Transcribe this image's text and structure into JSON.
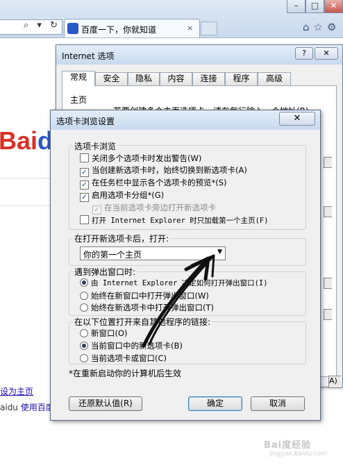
{
  "browser": {
    "window_buttons": [
      "–",
      "□",
      "✕"
    ],
    "tab_title": "百度一下，你就知道",
    "tab_close": "×",
    "address_icons": "⌕ ▾ ↻"
  },
  "page": {
    "logo_part1": "Bai",
    "logo_part2": "d",
    "set_homepage_link": "设为主页",
    "footer_prefix": "aidu",
    "footer_link": "使用百度"
  },
  "internet_options": {
    "title": "Internet 选项",
    "help_button": "?",
    "close_button": "✕",
    "tabs": [
      "常规",
      "安全",
      "隐私",
      "内容",
      "连接",
      "程序",
      "高级"
    ],
    "active_tab": "常规",
    "homepage_group_label": "主页",
    "homepage_desc": "若要创建多个主页选项卡，请在每行输入一个地址(R)。",
    "button_fragment": "A)"
  },
  "tab_settings": {
    "title": "选项卡浏览设置",
    "close_button": "✕",
    "group_tabbed": {
      "label": "选项卡浏览",
      "options": [
        {
          "label": "关闭多个选项卡时发出警告(W)",
          "checked": false,
          "enabled": true
        },
        {
          "label": "当创建新选项卡时，始终切换到新选项卡(A)",
          "checked": true,
          "enabled": true
        },
        {
          "label": "在任务栏中显示各个选项卡的预览*(S)",
          "checked": true,
          "enabled": true
        },
        {
          "label": "启用选项卡分组*(G)",
          "checked": true,
          "enabled": true
        },
        {
          "label": "在当前选项卡旁边打开新选项卡",
          "checked": true,
          "enabled": false
        },
        {
          "label": "打开 Internet Explorer 时只加载第一个主页(F)",
          "checked": false,
          "enabled": true
        }
      ]
    },
    "group_new_tab": {
      "label": "在打开新选项卡后，打开:",
      "selected": "你的第一个主页"
    },
    "group_popup": {
      "label": "遇到弹出窗口时:",
      "options": [
        {
          "label": "由 Internet Explorer 决定如何打开弹出窗口(I)",
          "selected": true
        },
        {
          "label": "始终在新窗口中打开弹出窗口(W)",
          "selected": false
        },
        {
          "label": "始终在新选项卡中打开弹出窗口(T)",
          "selected": false
        }
      ]
    },
    "group_links": {
      "label": "在以下位置打开来自其他程序的链接:",
      "options": [
        {
          "label": "新窗口(O)",
          "selected": false
        },
        {
          "label": "当前窗口中的新选项卡(B)",
          "selected": true
        },
        {
          "label": "当前选项卡或窗口(C)",
          "selected": false
        }
      ]
    },
    "note": "*在重新启动你的计算机后生效",
    "buttons": {
      "restore_defaults": "还原默认值(R)",
      "ok": "确定",
      "cancel": "取消"
    }
  },
  "watermark": {
    "text": "Bai度经验",
    "url": "jingyan.baidu.com"
  },
  "colors": {
    "annotation_arrow": "#111111",
    "logo_red": "#d93025",
    "logo_blue": "#2b56c9",
    "title_bar": "#c7d9ee"
  }
}
